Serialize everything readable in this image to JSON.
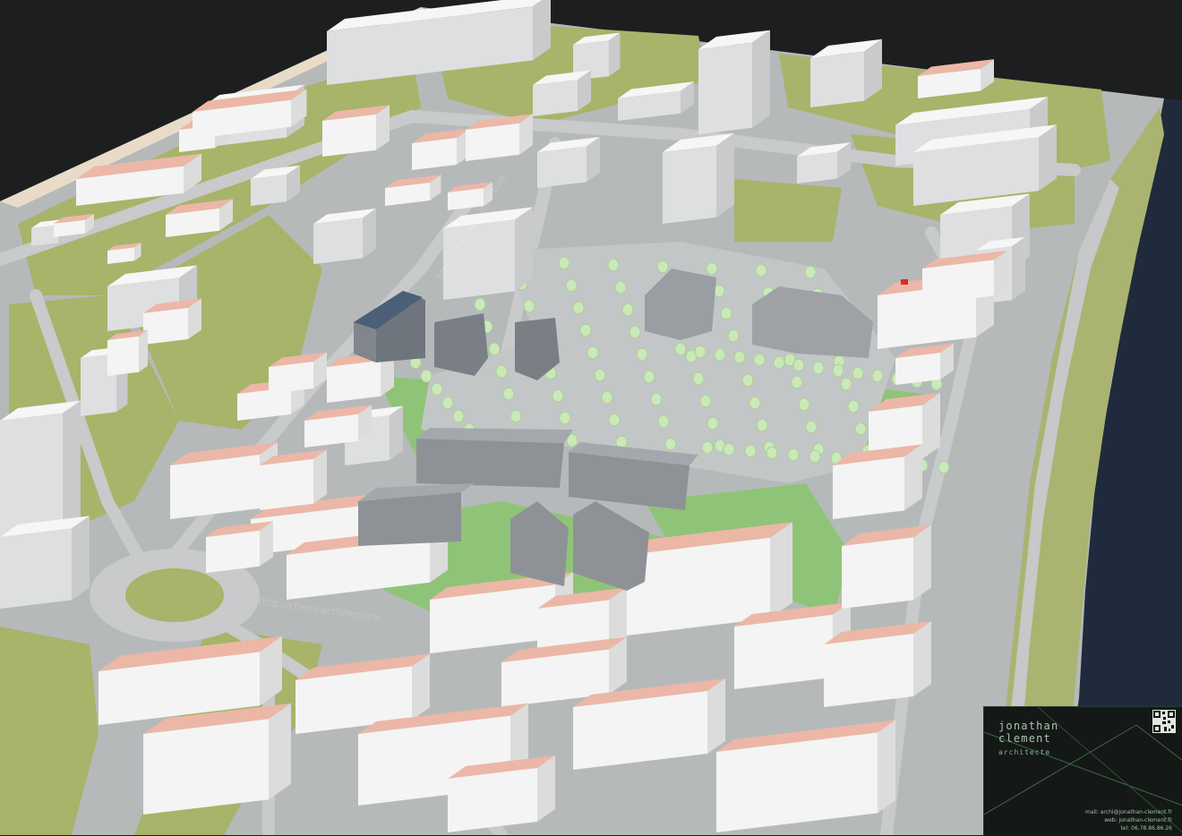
{
  "image": {
    "type": "3D aerial urban massing model",
    "colors": {
      "background": "#1d1e20",
      "ground_green": "#a7b46a",
      "road": "#b9bcbd",
      "sidewalk": "#c9cbcc",
      "building_white": "#ececec",
      "roof_pink": "#e9b3a2",
      "project_grey": "#8e9297",
      "lawn": "#8fc478",
      "tree": "#c8e8b8",
      "river": "#1f2b3c",
      "beach": "#e8dcc8"
    }
  },
  "watermark": {
    "text": "http://chenalarchitecture"
  },
  "branding": {
    "name_line1": "jonathan",
    "name_line2": "clement",
    "subtitle": "architecte",
    "mail": "mail: archi@jonathan-clement.fr",
    "web": "web: jonathan-clement.fr",
    "tel": "tel: 06.78.86.86.26",
    "qr_icon": "qr-code-icon"
  }
}
